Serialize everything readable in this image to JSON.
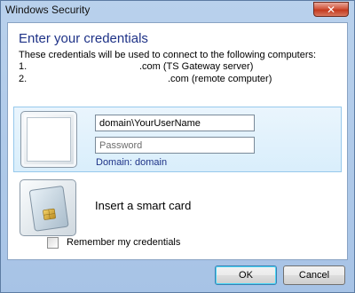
{
  "window": {
    "title": "Windows Security",
    "close_glyph": "✕"
  },
  "dialog": {
    "heading": "Enter your credentials",
    "description": "These credentials will be used to connect to the following computers:",
    "servers": [
      {
        "number": "1.",
        "host_suffix": ".com (TS Gateway server)"
      },
      {
        "number": "2.",
        "host_suffix": ".com (remote computer)"
      }
    ]
  },
  "credential_tile": {
    "icon": "user-frame-icon",
    "username_value": "domain\\YourUserName",
    "password_placeholder": "Password",
    "domain_text": "Domain: domain"
  },
  "smart_card_tile": {
    "icon": "smart-card-icon",
    "label": "Insert a smart card"
  },
  "remember": {
    "label": "Remember my credentials",
    "checked": false
  },
  "buttons": {
    "ok": "OK",
    "cancel": "Cancel"
  },
  "colors": {
    "heading": "#1e3287",
    "selection_tile": "#d9eefb",
    "frame": "#a7c3e6"
  }
}
